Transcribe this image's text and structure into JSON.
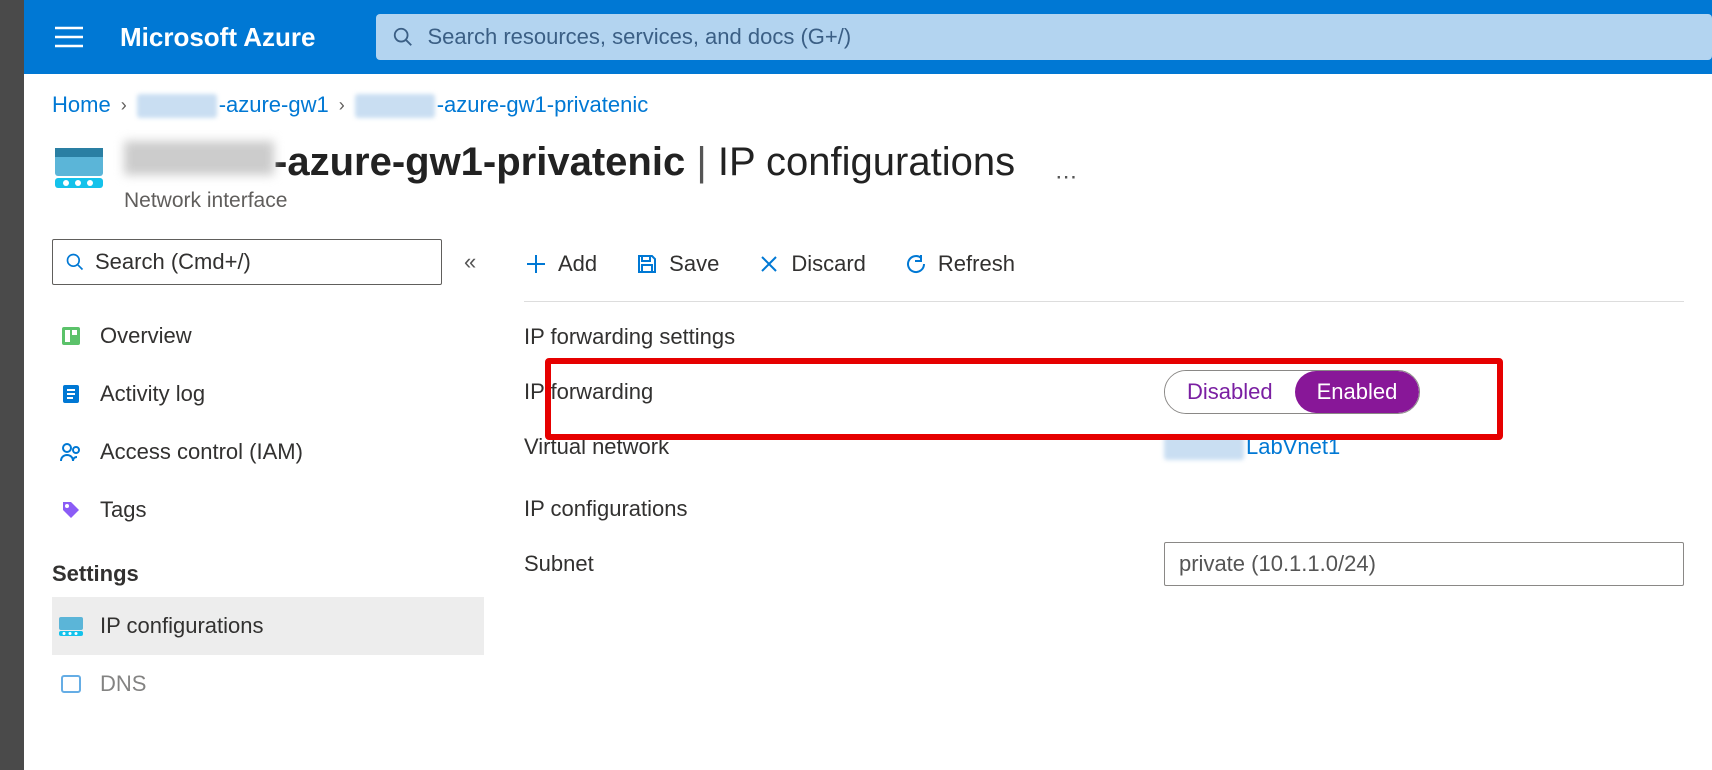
{
  "header": {
    "brand": "Microsoft Azure",
    "search_placeholder": "Search resources, services, and docs (G+/)"
  },
  "breadcrumb": {
    "home": "Home",
    "res1": "-azure-gw1",
    "res2": "-azure-gw1-privatenic"
  },
  "title": {
    "name": "-azure-gw1-privatenic",
    "section": "IP configurations",
    "subtype": "Network interface"
  },
  "side_search_placeholder": "Search (Cmd+/)",
  "sidebar": {
    "items": [
      {
        "label": "Overview"
      },
      {
        "label": "Activity log"
      },
      {
        "label": "Access control (IAM)"
      },
      {
        "label": "Tags"
      }
    ],
    "settings_header": "Settings",
    "settings_items": [
      {
        "label": "IP configurations"
      },
      {
        "label": "DNS"
      }
    ]
  },
  "toolbar": {
    "add": "Add",
    "save": "Save",
    "discard": "Discard",
    "refresh": "Refresh"
  },
  "form": {
    "ip_fwd_settings": "IP forwarding settings",
    "ip_fwd_label": "IP forwarding",
    "toggle_disabled": "Disabled",
    "toggle_enabled": "Enabled",
    "vnet_label": "Virtual network",
    "vnet_value_suffix": "LabVnet1",
    "ip_conf_heading": "IP configurations",
    "subnet_label": "Subnet",
    "subnet_value": "private (10.1.1.0/24)"
  }
}
